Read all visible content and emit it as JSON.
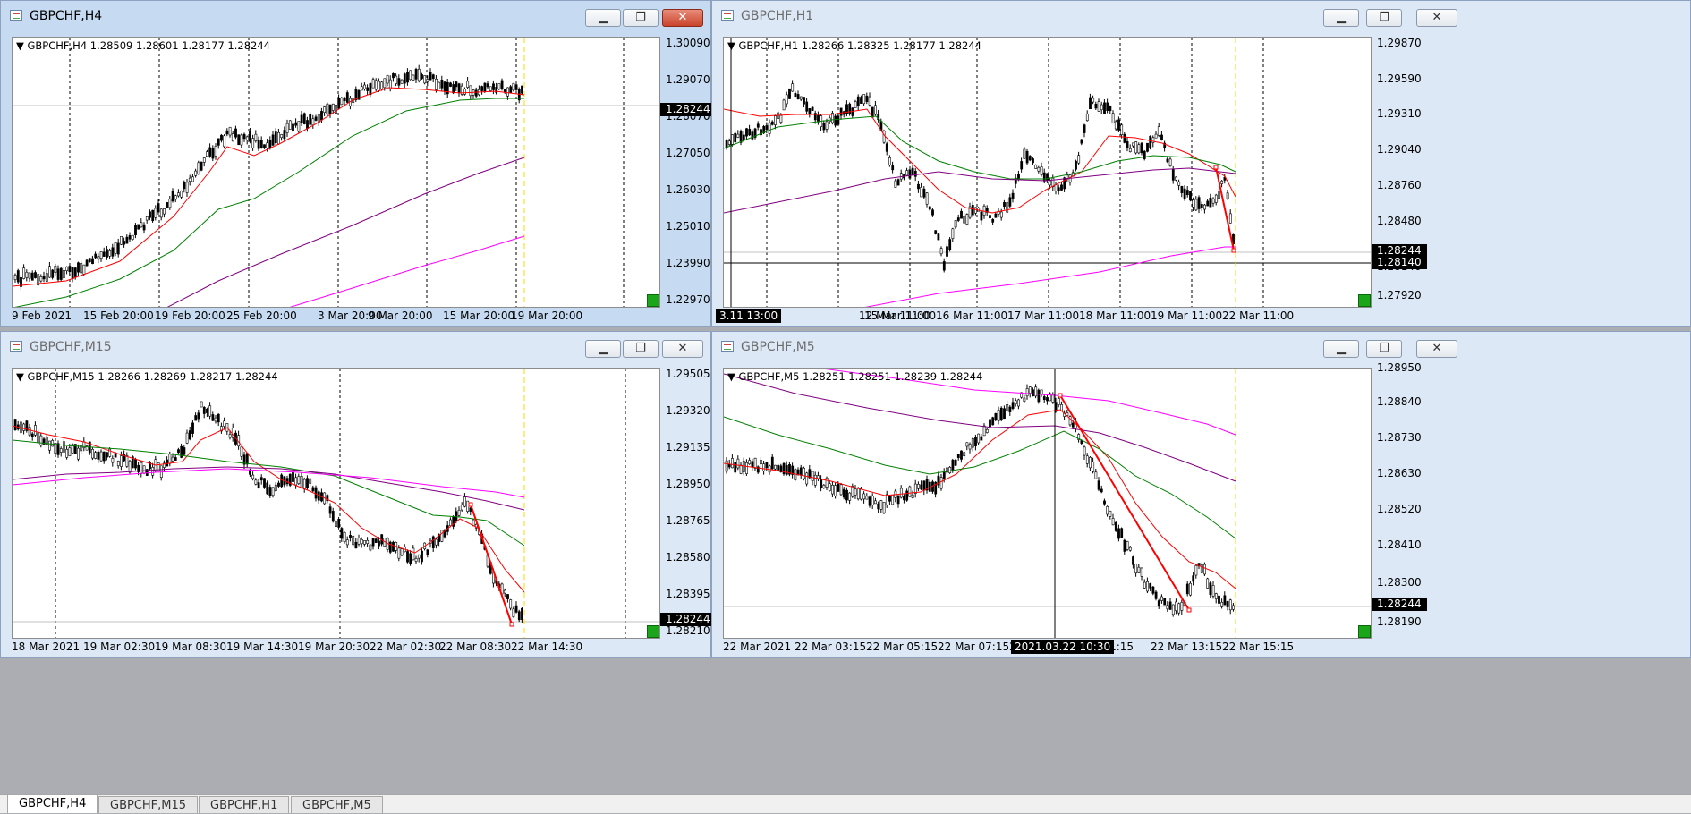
{
  "windows": [
    {
      "id": "h4",
      "title": "GBPCHF,H4",
      "active": true,
      "info": "GBPCHF,H4  1.28509 1.28601 1.28177 1.28244",
      "prices": [
        "1.30090",
        "1.29070",
        "1.28070",
        "1.27050",
        "1.26030",
        "1.25010",
        "1.23990",
        "1.22970"
      ],
      "current_price": "1.28244",
      "times": [
        "9 Feb 2021",
        "15 Feb 20:00",
        "19 Feb 20:00",
        "25 Feb 20:00",
        "3 Mar 20:00",
        "9 Mar 20:00",
        "15 Mar 20:00",
        "19 Mar 20:00"
      ],
      "time_cursor": ""
    },
    {
      "id": "h1",
      "title": "GBPCHF,H1",
      "active": false,
      "info": "GBPCHF,H1  1.28266 1.28325 1.28177 1.28244",
      "prices": [
        "1.29870",
        "1.29590",
        "1.29310",
        "1.29040",
        "1.28760",
        "1.28480",
        "1.28244",
        "1.28140",
        "1.27920"
      ],
      "current_price": "1.28244",
      "cursor_price": "1.28140",
      "times": [
        "1",
        "12 Mar 11:00",
        "15 Mar 11:00",
        "16 Mar 11:00",
        "17 Mar 11:00",
        "18 Mar 11:00",
        "19 Mar 11:00",
        "22 Mar 11:00"
      ],
      "time_cursor": "3.11 13:00"
    },
    {
      "id": "m15",
      "title": "GBPCHF,M15",
      "active": false,
      "info": "GBPCHF,M15  1.28266 1.28269 1.28217 1.28244",
      "prices": [
        "1.29505",
        "1.29320",
        "1.29135",
        "1.28950",
        "1.28765",
        "1.28580",
        "1.28395",
        "1.28210"
      ],
      "current_price": "1.28244",
      "times": [
        "18 Mar 2021",
        "19 Mar 02:30",
        "19 Mar 08:30",
        "19 Mar 14:30",
        "19 Mar 20:30",
        "22 Mar 02:30",
        "22 Mar 08:30",
        "22 Mar 14:30"
      ],
      "time_cursor": ""
    },
    {
      "id": "m5",
      "title": "GBPCHF,M5",
      "active": false,
      "info": "GBPCHF,M5  1.28251 1.28251 1.28239 1.28244",
      "prices": [
        "1.28950",
        "1.28840",
        "1.28730",
        "1.28630",
        "1.28520",
        "1.28410",
        "1.28300",
        "1.28244",
        "1.28190"
      ],
      "current_price": "1.28244",
      "times": [
        "22 Mar 2021",
        "22 Mar 03:15",
        "22 Mar 05:15",
        "22 Mar 07:15",
        "2",
        "Mar 11:15",
        "22 Mar 13:15",
        "22 Mar 15:15"
      ],
      "time_cursor": "2021.03.22 10:30"
    }
  ],
  "tabs": [
    "GBPCHF,H4",
    "GBPCHF,M15",
    "GBPCHF,H1",
    "GBPCHF,M5"
  ],
  "icons": {
    "minimize": "minimize-icon",
    "maximize": "maximize-icon",
    "close": "close-icon",
    "window": "chart-window-icon",
    "menu": "triangle-down-icon"
  },
  "colors": {
    "ma_fast": "#ff0000",
    "ma_mid": "#008000",
    "ma_slow": "#800080",
    "ma_long": "#ff00ff",
    "period_sep": "#ffd700",
    "grid": "#000000"
  }
}
